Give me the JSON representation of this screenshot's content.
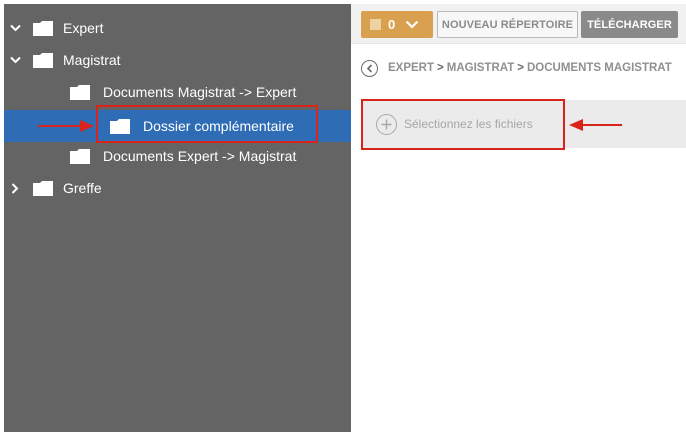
{
  "tree": {
    "items": [
      {
        "label": "Expert",
        "expanded": true
      },
      {
        "label": "Magistrat",
        "expanded": true
      },
      {
        "label": "Documents Magistrat -> Expert"
      },
      {
        "label": "Dossier complémentaire",
        "selected": true
      },
      {
        "label": "Documents Expert -> Magistrat"
      },
      {
        "label": "Greffe",
        "expanded": false
      }
    ]
  },
  "toolbar": {
    "select_count": "0",
    "new_folder_label": "NOUVEAU RÉPERTOIRE",
    "download_label": "TÉLÉCHARGER"
  },
  "breadcrumb": {
    "items": [
      "EXPERT",
      "MAGISTRAT",
      "DOCUMENTS MAGISTRAT"
    ],
    "separator": ">"
  },
  "upload": {
    "label": "Sélectionnez les fichiers"
  },
  "colors": {
    "sidebar_bg": "#646464",
    "selected_bg": "#2f6cb6",
    "accent": "#d8a04f",
    "annotation": "#d9241b"
  }
}
